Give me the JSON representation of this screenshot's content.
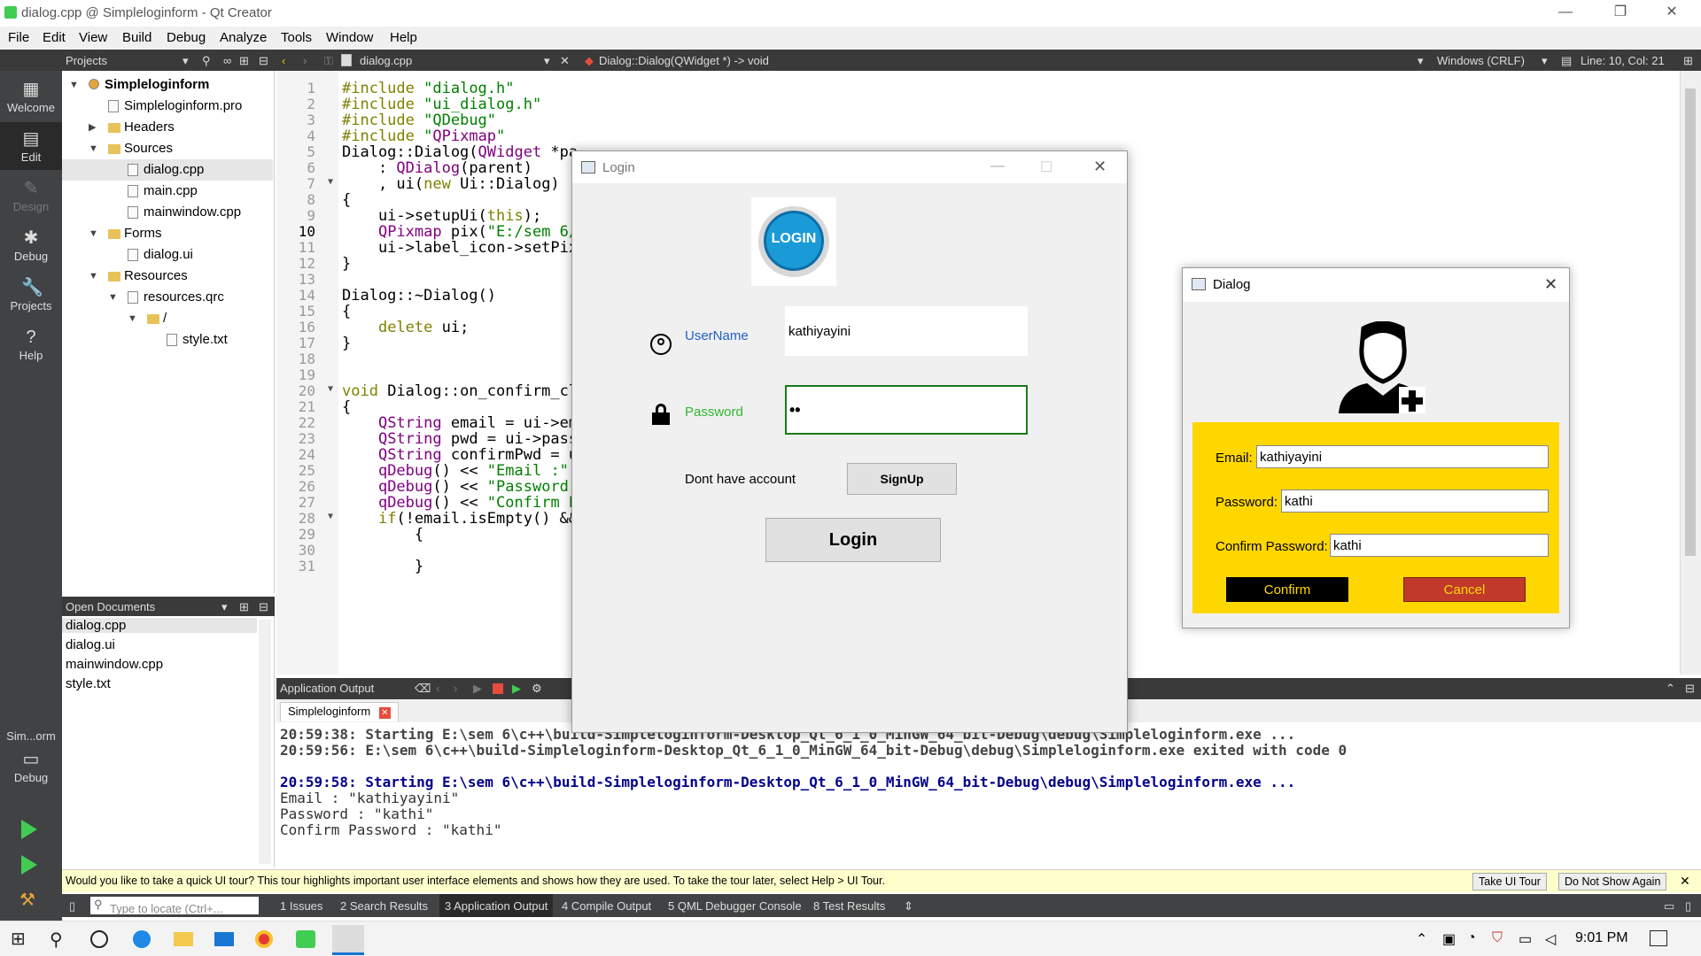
{
  "window": {
    "title": "dialog.cpp @ Simpleloginform - Qt Creator",
    "minimize": "—",
    "restore": "❐",
    "close": "✕"
  },
  "menu": [
    "File",
    "Edit",
    "View",
    "Build",
    "Debug",
    "Analyze",
    "Tools",
    "Window",
    "Help"
  ],
  "toolbar": {
    "projects_label": "Projects",
    "file_tab": "dialog.cpp",
    "function_sig": "Dialog::Dialog(QWidget *) -> void",
    "line_ending": "Windows (CRLF)",
    "cursor_pos": "Line: 10, Col: 21"
  },
  "modes": [
    {
      "label": "Welcome",
      "icon": "grid-icon"
    },
    {
      "label": "Edit",
      "icon": "edit-icon"
    },
    {
      "label": "Design",
      "icon": "pencil-icon"
    },
    {
      "label": "Debug",
      "icon": "bug-icon"
    },
    {
      "label": "Projects",
      "icon": "wrench-icon"
    },
    {
      "label": "Help",
      "icon": "help-icon"
    }
  ],
  "kit": {
    "name": "Sim...orm",
    "mode": "Debug"
  },
  "project_tree": [
    {
      "label": "Simpleloginform",
      "depth": 0,
      "arrow": "down",
      "icon": "project",
      "bold": true
    },
    {
      "label": "Simpleloginform.pro",
      "depth": 1,
      "arrow": "",
      "icon": "file"
    },
    {
      "label": "Headers",
      "depth": 1,
      "arrow": "right",
      "icon": "folder"
    },
    {
      "label": "Sources",
      "depth": 1,
      "arrow": "down",
      "icon": "folder"
    },
    {
      "label": "dialog.cpp",
      "depth": 2,
      "arrow": "",
      "icon": "file",
      "selected": true
    },
    {
      "label": "main.cpp",
      "depth": 2,
      "arrow": "",
      "icon": "file"
    },
    {
      "label": "mainwindow.cpp",
      "depth": 2,
      "arrow": "",
      "icon": "file"
    },
    {
      "label": "Forms",
      "depth": 1,
      "arrow": "down",
      "icon": "folder"
    },
    {
      "label": "dialog.ui",
      "depth": 2,
      "arrow": "",
      "icon": "file"
    },
    {
      "label": "Resources",
      "depth": 1,
      "arrow": "down",
      "icon": "folder"
    },
    {
      "label": "resources.qrc",
      "depth": 2,
      "arrow": "down",
      "icon": "file"
    },
    {
      "label": "/",
      "depth": 3,
      "arrow": "down",
      "icon": "folder"
    },
    {
      "label": "style.txt",
      "depth": 4,
      "arrow": "",
      "icon": "file"
    }
  ],
  "open_documents": {
    "header": "Open Documents",
    "items": [
      "dialog.cpp",
      "dialog.ui",
      "mainwindow.cpp",
      "style.txt"
    ]
  },
  "code_lines": [
    {
      "n": "1",
      "t": "#include \"dialog.h\""
    },
    {
      "n": "2",
      "t": "#include \"ui_dialog.h\""
    },
    {
      "n": "3",
      "t": "#include \"QDebug\""
    },
    {
      "n": "4",
      "t": "#include \"QPixmap\""
    },
    {
      "n": "5",
      "t": "Dialog::Dialog(QWidget *pa"
    },
    {
      "n": "6",
      "t": "    : QDialog(parent)"
    },
    {
      "n": "7",
      "t": "    , ui(new Ui::Dialog)"
    },
    {
      "n": "8",
      "t": "{"
    },
    {
      "n": "9",
      "t": "    ui->setupUi(this);"
    },
    {
      "n": "10",
      "t": "    QPixmap pix(\"E:/sem 6/"
    },
    {
      "n": "11",
      "t": "    ui->label_icon->setPix"
    },
    {
      "n": "12",
      "t": "}"
    },
    {
      "n": "13",
      "t": ""
    },
    {
      "n": "14",
      "t": "Dialog::~Dialog()"
    },
    {
      "n": "15",
      "t": "{"
    },
    {
      "n": "16",
      "t": "    delete ui;"
    },
    {
      "n": "17",
      "t": "}"
    },
    {
      "n": "18",
      "t": ""
    },
    {
      "n": "19",
      "t": ""
    },
    {
      "n": "20",
      "t": "void Dialog::on_confirm_cl"
    },
    {
      "n": "21",
      "t": "{"
    },
    {
      "n": "22",
      "t": "    QString email = ui->em"
    },
    {
      "n": "23",
      "t": "    QString pwd = ui->pass"
    },
    {
      "n": "24",
      "t": "    QString confirmPwd = u"
    },
    {
      "n": "25",
      "t": "    qDebug() << \"Email :\""
    },
    {
      "n": "26",
      "t": "    qDebug() << \"Password"
    },
    {
      "n": "27",
      "t": "    qDebug() << \"Confirm P"
    },
    {
      "n": "28",
      "t": "    if(!email.isEmpty() &&"
    },
    {
      "n": "29",
      "t": "        {"
    },
    {
      "n": "30",
      "t": ""
    },
    {
      "n": "31",
      "t": "        }"
    }
  ],
  "output": {
    "header": "Application Output",
    "tab": "Simpleloginform",
    "lines": [
      {
        "t": "20:59:38: Starting E:\\sem 6\\c++\\build-Simpleloginform-Desktop_Qt_6_1_0_MinGW_64_bit-Debug\\debug\\Simpleloginform.exe ...",
        "s": "g"
      },
      {
        "t": "20:59:56: E:\\sem 6\\c++\\build-Simpleloginform-Desktop_Qt_6_1_0_MinGW_64_bit-Debug\\debug\\Simpleloginform.exe exited with code 0",
        "s": "g"
      },
      {
        "t": "",
        "s": "n"
      },
      {
        "t": "20:59:58: Starting E:\\sem 6\\c++\\build-Simpleloginform-Desktop_Qt_6_1_0_MinGW_64_bit-Debug\\debug\\Simpleloginform.exe ...",
        "s": "b"
      },
      {
        "t": "Email : \"kathiyayini\"",
        "s": "n"
      },
      {
        "t": "Password : \"kathi\"",
        "s": "n"
      },
      {
        "t": "Confirm Password : \"kathi\"",
        "s": "n"
      }
    ]
  },
  "tour": {
    "message": "Would you like to take a quick UI tour? This tour highlights important user interface elements and shows how they are used. To take the tour later, select Help > UI Tour.",
    "take": "Take UI Tour",
    "dont_show": "Do Not Show Again"
  },
  "bottom_tabs": [
    "1  Issues",
    "2  Search Results",
    "3  Application Output",
    "4  Compile Output",
    "5  QML Debugger Console",
    "8  Test Results"
  ],
  "locator_placeholder": "Type to locate (Ctrl+...",
  "taskbar": {
    "time": "9:01 PM"
  },
  "login": {
    "title": "Login",
    "logo_text": "LOGIN",
    "username_label": "UserName",
    "username_value": "kathiyayini",
    "password_label": "Password",
    "password_value": "••",
    "no_account": "Dont have account",
    "signup": "SignUp",
    "login": "Login"
  },
  "dialog": {
    "title": "Dialog",
    "email_label": "Email:",
    "email_value": "kathiyayini",
    "password_label": "Password:",
    "password_value": "kathi",
    "confirm_label": "Confirm Password:",
    "confirm_value": "kathi",
    "confirm_btn": "Confirm",
    "cancel_btn": "Cancel"
  },
  "colors": {
    "yellow_panel": "#ffd700",
    "cancel_red": "#c0392b",
    "confirm_black": "#000000",
    "password_green": "#2eb82e",
    "username_blue": "#1e5fc9"
  }
}
